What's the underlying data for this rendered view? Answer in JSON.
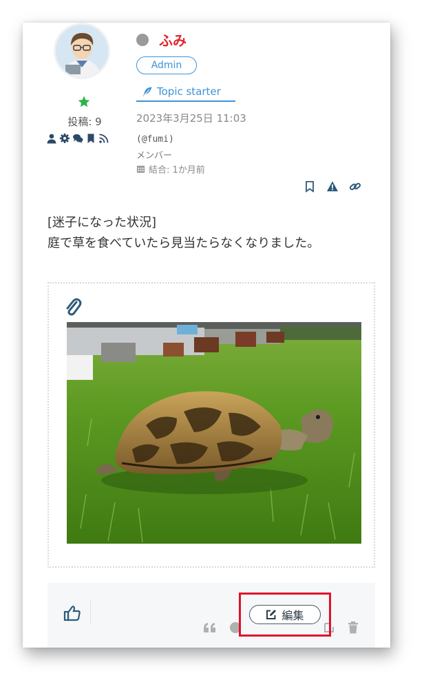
{
  "user": {
    "name": "ふみ",
    "role": "Admin",
    "topic_starter": "Topic starter",
    "posts": "投稿: 9",
    "handle": "(@fumi)",
    "member_title": "メンバー",
    "joined": "結合: 1か月前"
  },
  "post": {
    "date": "2023年3月25日 11:03",
    "lines": [
      "[迷子になった状況]",
      "庭で草を食べていたら見当たらなくなりました。"
    ]
  },
  "footer": {
    "edit_label": "編集"
  },
  "colors": {
    "username": "#e0252b",
    "accent": "#3d92d8",
    "highlight": "#e0102a"
  },
  "icons": [
    "star-icon",
    "user-icon",
    "gear-icon",
    "comments-icon",
    "bookmark-icon",
    "rss-icon",
    "feather-icon",
    "calendar-icon",
    "bookmark-outline-icon",
    "warning-icon",
    "link-icon",
    "paperclip-icon",
    "thumbs-up-icon",
    "quote-icon",
    "info-icon",
    "edit-icon",
    "trash-icon"
  ]
}
